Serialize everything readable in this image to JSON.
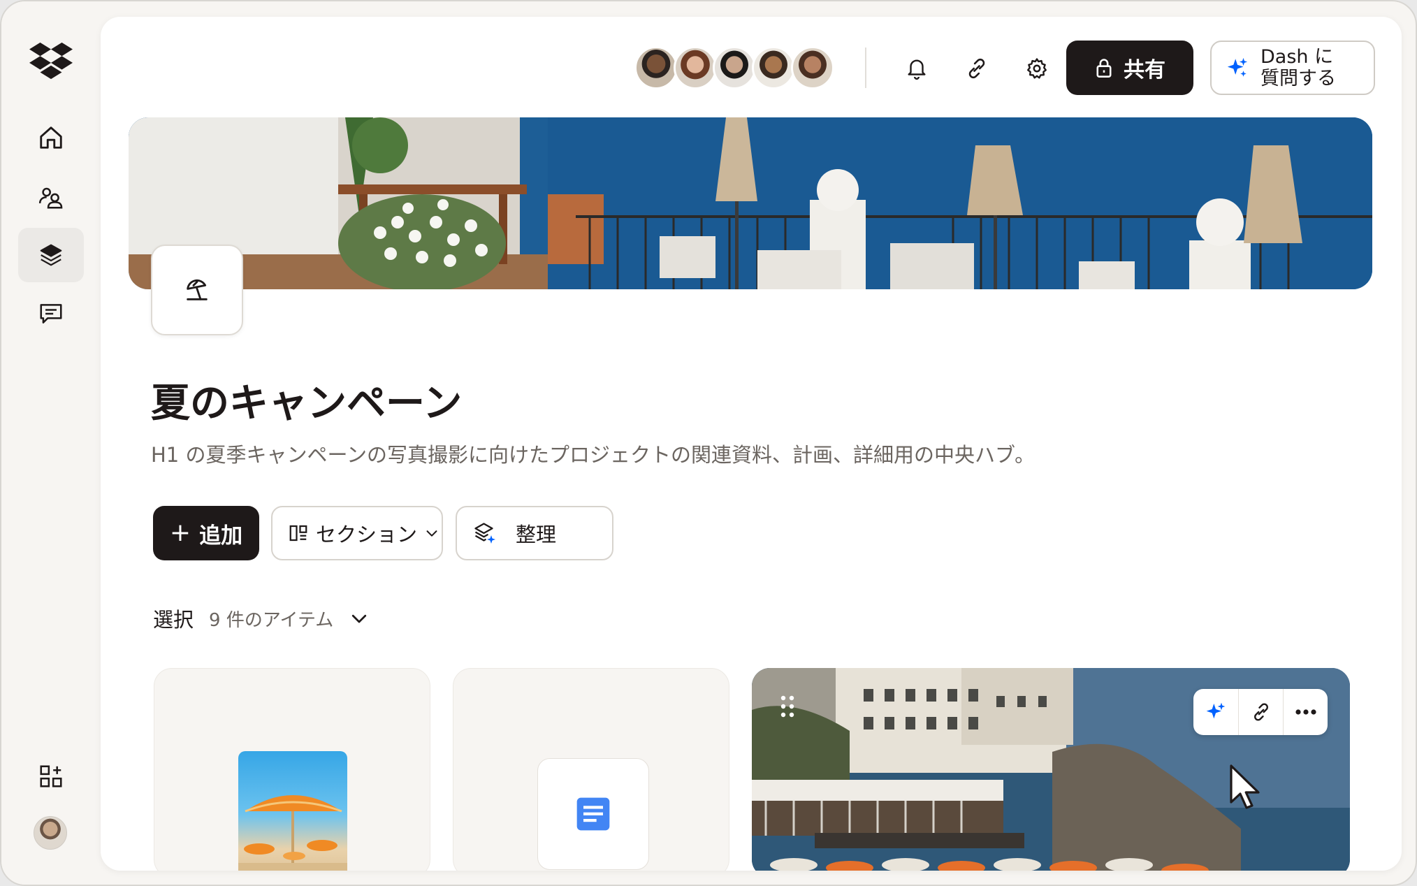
{
  "header": {
    "share_label": "共有",
    "dash_label_line1": "Dash に",
    "dash_label_line2": "質問する"
  },
  "page": {
    "title": "夏のキャンペーン",
    "description": "H1 の夏季キャンペーンの写真撮影に向けたプロジェクトの関連資料、計画、詳細用の中央ハブ。"
  },
  "actions": {
    "add_label": "追加",
    "section_label": "セクション",
    "organize_label": "整理"
  },
  "selection": {
    "label": "選択",
    "count": "9 件のアイテム"
  },
  "icons": {
    "sidebar": [
      "dropbox-logo",
      "home-icon",
      "people-icon",
      "layers-icon",
      "chat-icon",
      "apps-add-icon",
      "user-avatar"
    ],
    "header": [
      "bell-icon",
      "link-icon",
      "gear-icon",
      "lock-icon",
      "sparkle-icon"
    ],
    "cover": "beach-umbrella-icon",
    "cards": [
      "image-thumbnail",
      "document-icon",
      "sparkle-icon",
      "link-icon",
      "more-icon",
      "drag-handle-icon"
    ]
  },
  "colors": {
    "accent_blue": "#0061fe",
    "dark": "#1e1919",
    "doc_blue": "#4285f4"
  }
}
